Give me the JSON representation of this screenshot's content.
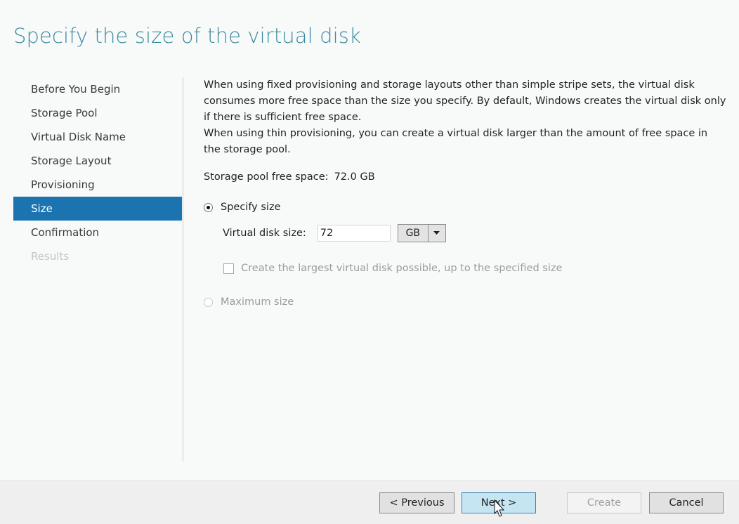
{
  "page": {
    "title": "Specify the size of the virtual disk"
  },
  "nav": {
    "items": [
      {
        "label": "Before You Begin",
        "state": "normal"
      },
      {
        "label": "Storage Pool",
        "state": "normal"
      },
      {
        "label": "Virtual Disk Name",
        "state": "normal"
      },
      {
        "label": "Storage Layout",
        "state": "normal"
      },
      {
        "label": "Provisioning",
        "state": "normal"
      },
      {
        "label": "Size",
        "state": "active"
      },
      {
        "label": "Confirmation",
        "state": "normal"
      },
      {
        "label": "Results",
        "state": "disabled"
      }
    ]
  },
  "content": {
    "description": [
      "When using fixed provisioning and storage layouts other than simple stripe sets, the virtual disk consumes more free space than the size you specify. By default, Windows creates the virtual disk only if there is sufficient free space.",
      "When using thin provisioning, you can create a virtual disk larger than the amount of free space in the storage pool."
    ],
    "free_space_label": "Storage pool free space:",
    "free_space_value": "72.0 GB",
    "specify_size": {
      "label": "Specify size",
      "selected": true,
      "disk_size_label": "Virtual disk size:",
      "disk_size_value": "72",
      "unit": "GB"
    },
    "largest_possible": {
      "label": "Create the largest virtual disk possible, up to the specified size",
      "checked": false,
      "enabled": false
    },
    "maximum_size": {
      "label": "Maximum size",
      "selected": false,
      "enabled": false
    }
  },
  "footer": {
    "previous": "< Previous",
    "next": "Next >",
    "create": "Create",
    "cancel": "Cancel"
  },
  "colors": {
    "title": "#3a8aa0",
    "nav_active": "#1b74b0",
    "next_button": "#c5e5f3"
  }
}
